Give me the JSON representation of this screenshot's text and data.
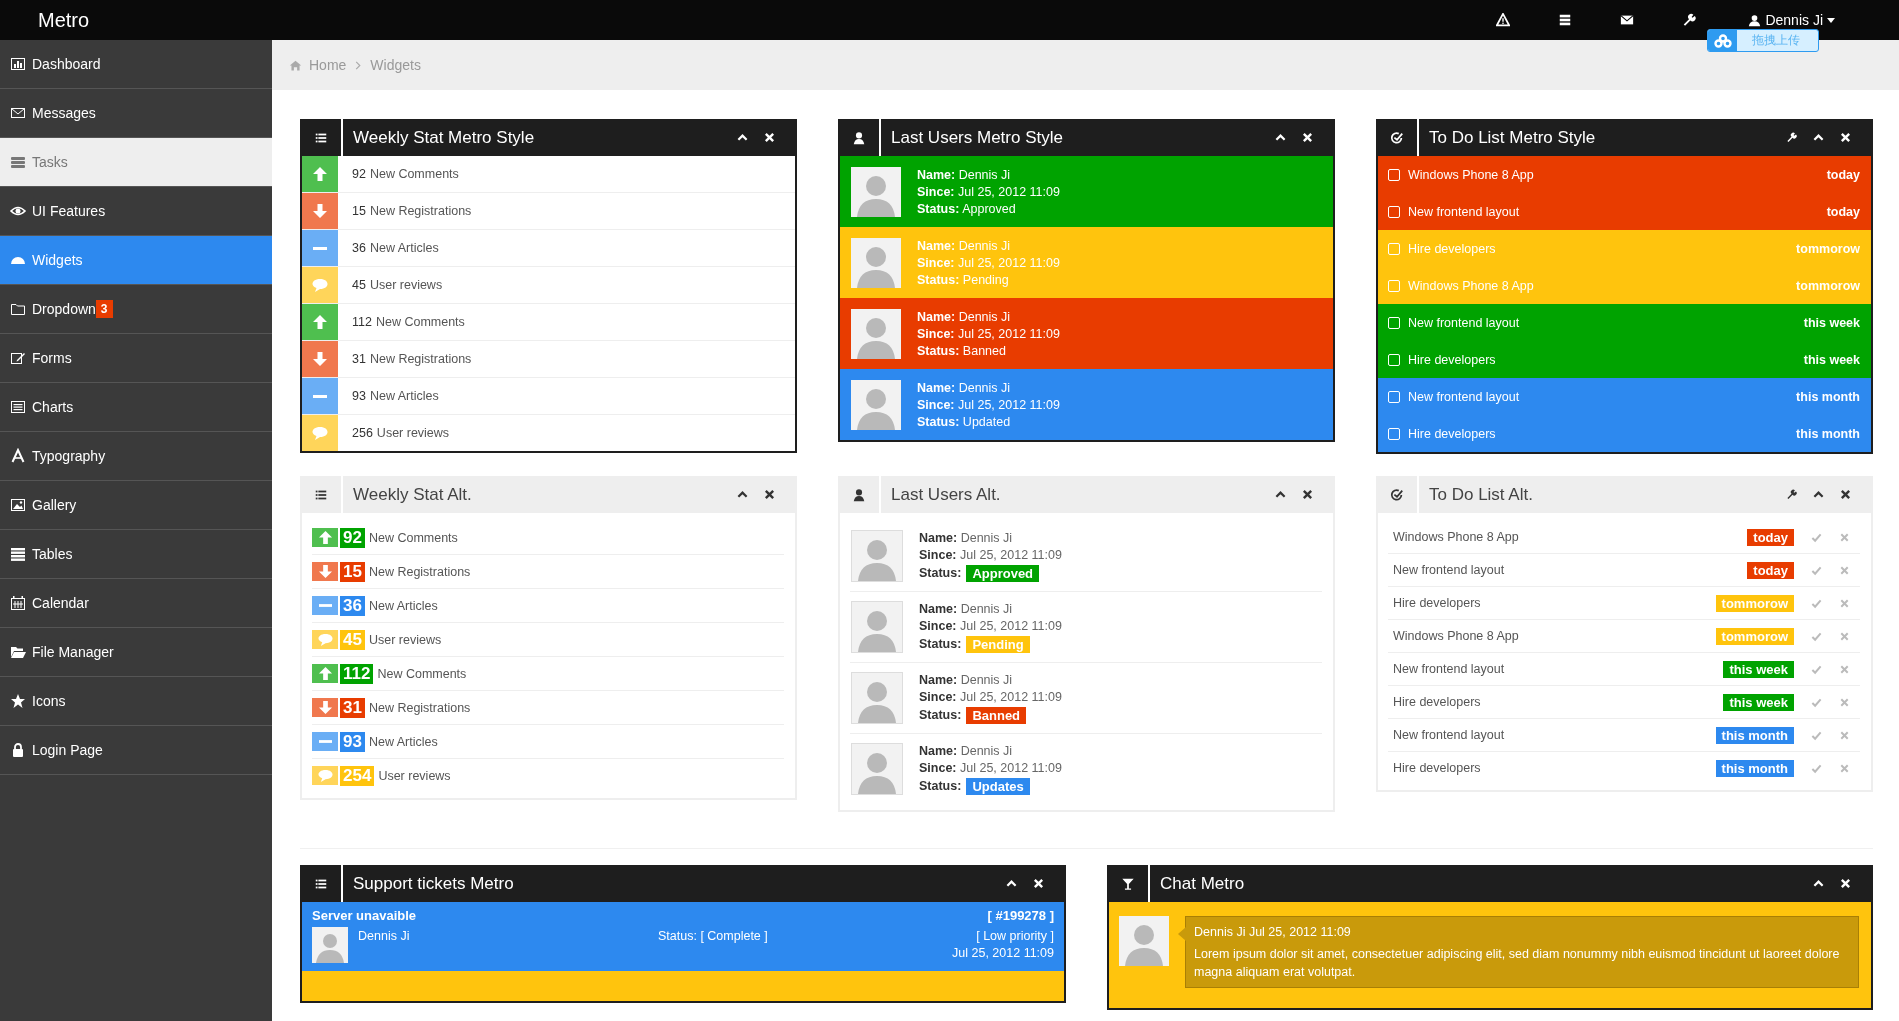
{
  "topbar": {
    "brand": "Metro",
    "user": "Dennis Ji"
  },
  "upload_button": {
    "label": "拖拽上传"
  },
  "sidebar": {
    "items": [
      {
        "label": "Dashboard",
        "selected": false,
        "hovered": false
      },
      {
        "label": "Messages",
        "selected": false,
        "hovered": false
      },
      {
        "label": "Tasks",
        "selected": false,
        "hovered": true
      },
      {
        "label": "UI Features",
        "selected": false,
        "hovered": false
      },
      {
        "label": "Widgets",
        "selected": true,
        "hovered": false
      },
      {
        "label": "Dropdown",
        "badge": "3",
        "selected": false,
        "hovered": false
      },
      {
        "label": "Forms",
        "selected": false,
        "hovered": false
      },
      {
        "label": "Charts",
        "selected": false,
        "hovered": false
      },
      {
        "label": "Typography",
        "selected": false,
        "hovered": false
      },
      {
        "label": "Gallery",
        "selected": false,
        "hovered": false
      },
      {
        "label": "Tables",
        "selected": false,
        "hovered": false
      },
      {
        "label": "Calendar",
        "selected": false,
        "hovered": false
      },
      {
        "label": "File Manager",
        "selected": false,
        "hovered": false
      },
      {
        "label": "Icons",
        "selected": false,
        "hovered": false
      },
      {
        "label": "Login Page",
        "selected": false,
        "hovered": false
      }
    ]
  },
  "breadcrumb": [
    "Home",
    "Widgets"
  ],
  "weekly_metro": {
    "title": "Weekly Stat Metro Style",
    "rows": [
      {
        "kind": "up",
        "count": "92",
        "label": "New Comments"
      },
      {
        "kind": "down",
        "count": "15",
        "label": "New Registrations"
      },
      {
        "kind": "flat",
        "count": "36",
        "label": "New Articles"
      },
      {
        "kind": "comment",
        "count": "45",
        "label": "User reviews"
      },
      {
        "kind": "up",
        "count": "112",
        "label": "New Comments"
      },
      {
        "kind": "down",
        "count": "31",
        "label": "New Registrations"
      },
      {
        "kind": "flat",
        "count": "93",
        "label": "New Articles"
      },
      {
        "kind": "comment",
        "count": "256",
        "label": "User reviews"
      }
    ]
  },
  "users_metro": {
    "title": "Last Users Metro Style",
    "rows": [
      {
        "kind": "approved",
        "lines": [
          "**Name:** Dennis Ji",
          "**Since:** Jul 25, 2012 11:09",
          "**Status:** Approved"
        ]
      },
      {
        "kind": "pending",
        "lines": [
          "**Name:** Dennis Ji",
          "**Since:** Jul 25, 2012 11:09",
          "**Status:** Pending"
        ]
      },
      {
        "kind": "banned",
        "lines": [
          "**Name:** Dennis Ji",
          "**Since:** Jul 25, 2012 11:09",
          "**Status:** Banned"
        ]
      },
      {
        "kind": "updated",
        "lines": [
          "**Name:** Dennis Ji",
          "**Since:** Jul 25, 2012 11:09",
          "**Status:** Updated"
        ]
      }
    ]
  },
  "todo_metro": {
    "title": "To Do List Metro Style",
    "items": [
      {
        "kind": "today",
        "label": "Windows Phone 8 App",
        "due": "today",
        "checked": false
      },
      {
        "kind": "today",
        "label": "New frontend layout",
        "due": "today",
        "checked": false
      },
      {
        "kind": "tomorrow",
        "label": "Hire developers",
        "due": "tommorow",
        "checked": false
      },
      {
        "kind": "tomorrow",
        "label": "Windows Phone 8 App",
        "due": "tommorow",
        "checked": false
      },
      {
        "kind": "week",
        "label": "New frontend layout",
        "due": "this week",
        "checked": false
      },
      {
        "kind": "week",
        "label": "Hire developers",
        "due": "this week",
        "checked": false
      },
      {
        "kind": "month",
        "label": "New frontend layout",
        "due": "this month",
        "checked": false
      },
      {
        "kind": "month",
        "label": "Hire developers",
        "due": "this month",
        "checked": false
      }
    ]
  },
  "weekly_alt": {
    "title": "Weekly Stat Alt.",
    "rows": [
      {
        "kind": "up",
        "count": "92",
        "label": "New Comments"
      },
      {
        "kind": "down",
        "count": "15",
        "label": "New Registrations"
      },
      {
        "kind": "flat",
        "count": "36",
        "label": "New Articles"
      },
      {
        "kind": "comment",
        "count": "45",
        "label": "User reviews"
      },
      {
        "kind": "up",
        "count": "112",
        "label": "New Comments"
      },
      {
        "kind": "down",
        "count": "31",
        "label": "New Registrations"
      },
      {
        "kind": "flat",
        "count": "93",
        "label": "New Articles"
      },
      {
        "kind": "comment",
        "count": "254",
        "label": "User reviews"
      }
    ]
  },
  "users_alt": {
    "title": "Last Users Alt.",
    "rows": [
      {
        "kind": "approved",
        "lines": [
          "**Name:** Dennis Ji",
          "**Since:** Jul 25, 2012 11:09"
        ],
        "status_label": "Status:",
        "status": "Approved"
      },
      {
        "kind": "pending",
        "lines": [
          "**Name:** Dennis Ji",
          "**Since:** Jul 25, 2012 11:09"
        ],
        "status_label": "Status:",
        "status": "Pending"
      },
      {
        "kind": "banned",
        "lines": [
          "**Name:** Dennis Ji",
          "**Since:** Jul 25, 2012 11:09"
        ],
        "status_label": "Status:",
        "status": "Banned"
      },
      {
        "kind": "updated",
        "lines": [
          "**Name:** Dennis Ji",
          "**Since:** Jul 25, 2012 11:09"
        ],
        "status_label": "Status:",
        "status": "Updates"
      }
    ]
  },
  "todo_alt": {
    "title": "To Do List Alt.",
    "items": [
      {
        "kind": "today",
        "label": "Windows Phone 8 App",
        "due": "today"
      },
      {
        "kind": "today",
        "label": "New frontend layout",
        "due": "today"
      },
      {
        "kind": "tomorrow",
        "label": "Hire developers",
        "due": "tommorow"
      },
      {
        "kind": "tomorrow",
        "label": "Windows Phone 8 App",
        "due": "tommorow"
      },
      {
        "kind": "week",
        "label": "New frontend layout",
        "due": "this week"
      },
      {
        "kind": "week",
        "label": "Hire developers",
        "due": "this week"
      },
      {
        "kind": "month",
        "label": "New frontend layout",
        "due": "this month"
      },
      {
        "kind": "month",
        "label": "Hire developers",
        "due": "this month"
      }
    ]
  },
  "tickets": {
    "title": "Support tickets Metro",
    "ticket": {
      "subject": "Server unavaible",
      "number": "[ #199278 ]",
      "name": "Dennis Ji",
      "status": "Status: [ Complete ]",
      "priority": "[ Low priority ]",
      "date": "Jul 25, 2012 11:09"
    }
  },
  "chat": {
    "title": "Chat Metro",
    "message": {
      "author": "Dennis Ji Jul 25, 2012 11:09",
      "text": "Lorem ipsum dolor sit amet, consectetuer adipiscing elit, sed diam nonummy nibh euismod tincidunt ut laoreet dolore magna aliquam erat volutpat."
    }
  }
}
